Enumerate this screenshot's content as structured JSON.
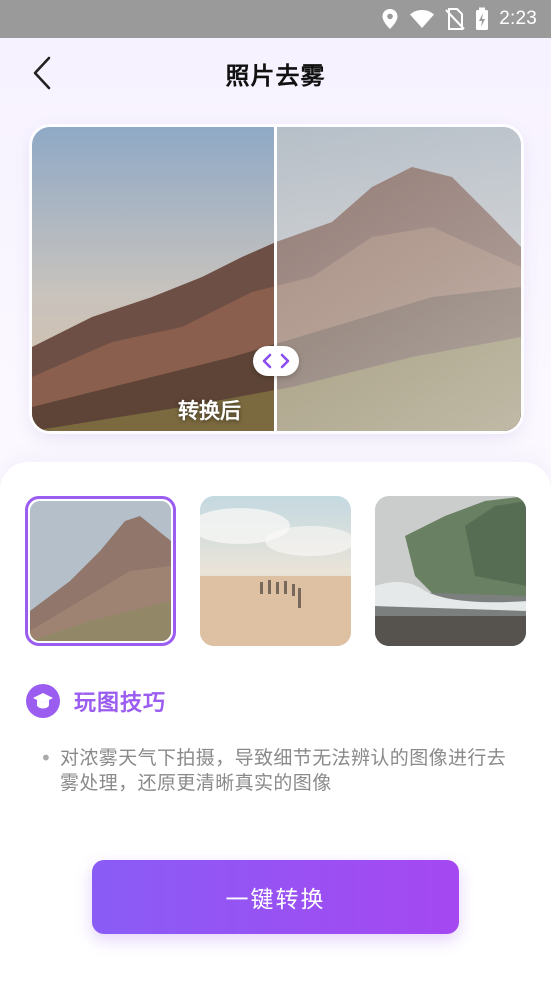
{
  "status_bar": {
    "time": "2:23",
    "icons": [
      "location-icon",
      "wifi-icon",
      "no-sim-icon",
      "battery-charging-icon"
    ]
  },
  "header": {
    "title": "照片去雾",
    "back_icon": "chevron-left-icon"
  },
  "compare": {
    "after_label": "转换后",
    "handle_icon": "left-right-arrows-icon"
  },
  "samples": [
    {
      "name": "mountain",
      "selected": true
    },
    {
      "name": "desert-caravan",
      "selected": false
    },
    {
      "name": "coastal-cliff",
      "selected": false
    }
  ],
  "tips": {
    "icon": "graduation-cap-icon",
    "title": "玩图技巧",
    "bullet": "•",
    "text": "对浓雾天气下拍摄，导致细节无法辨认的图像进行去雾处理，还原更清晰真实的图像"
  },
  "action": {
    "convert_label": "一键转换"
  },
  "colors": {
    "accent": "#9b5cf0",
    "button_start": "#8a5cf5",
    "button_end": "#a548f2",
    "status_bar": "#9a9a9a"
  }
}
